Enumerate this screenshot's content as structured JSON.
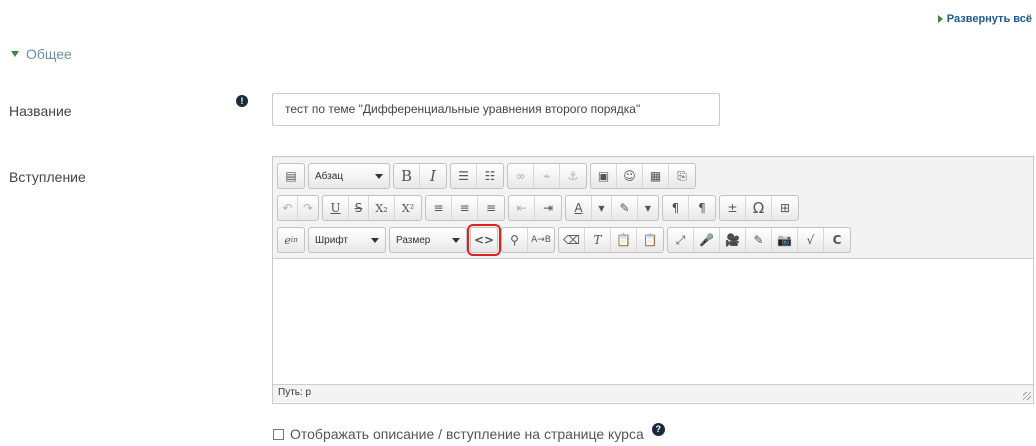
{
  "header": {
    "expand_all": "Развернуть всё"
  },
  "section": {
    "title": "Общее"
  },
  "fields": {
    "name_label": "Название",
    "name_required_icon": "!",
    "name_value": "тест по теме \"Дифференциальные уравнения второго порядка\"",
    "intro_label": "Вступление"
  },
  "toolbar": {
    "paragraph": "Абзац",
    "font": "Шрифт",
    "size": "Размер",
    "row1": [
      "show-toolbar-icon",
      "bold-icon",
      "italic-icon",
      "bullet-list-icon",
      "numbered-list-icon",
      "link-icon",
      "unlink-icon",
      "anchor-icon",
      "image-icon",
      "emoticon-icon",
      "media-icon",
      "template-icon"
    ],
    "row2": [
      "undo-icon",
      "redo-icon",
      "underline-icon",
      "strikethrough-icon",
      "subscript-icon",
      "superscript-icon",
      "align-left-icon",
      "align-center-icon",
      "align-right-icon",
      "outdent-icon",
      "indent-icon",
      "text-color-icon",
      "background-color-icon",
      "ltr-icon",
      "rtl-icon",
      "insert-line-icon",
      "special-chars-icon",
      "table-icon"
    ],
    "row3": [
      "equation-icon",
      "code-icon",
      "search-icon",
      "replace-icon",
      "cleanup-icon",
      "clear-format-icon",
      "paste-text-icon",
      "paste-word-icon",
      "fullscreen-icon",
      "record-audio-icon",
      "record-video-icon",
      "draw-icon",
      "camera-icon",
      "math-icon",
      "loop-icon"
    ]
  },
  "editor": {
    "path": "Путь: p"
  },
  "checkbox": {
    "label": "Отображать описание / вступление на странице курса",
    "checked": false,
    "help": "?"
  },
  "colors": {
    "accent_green": "#3a8b3a",
    "highlight_red": "#e02020",
    "link_blue": "#1f5a8a"
  }
}
